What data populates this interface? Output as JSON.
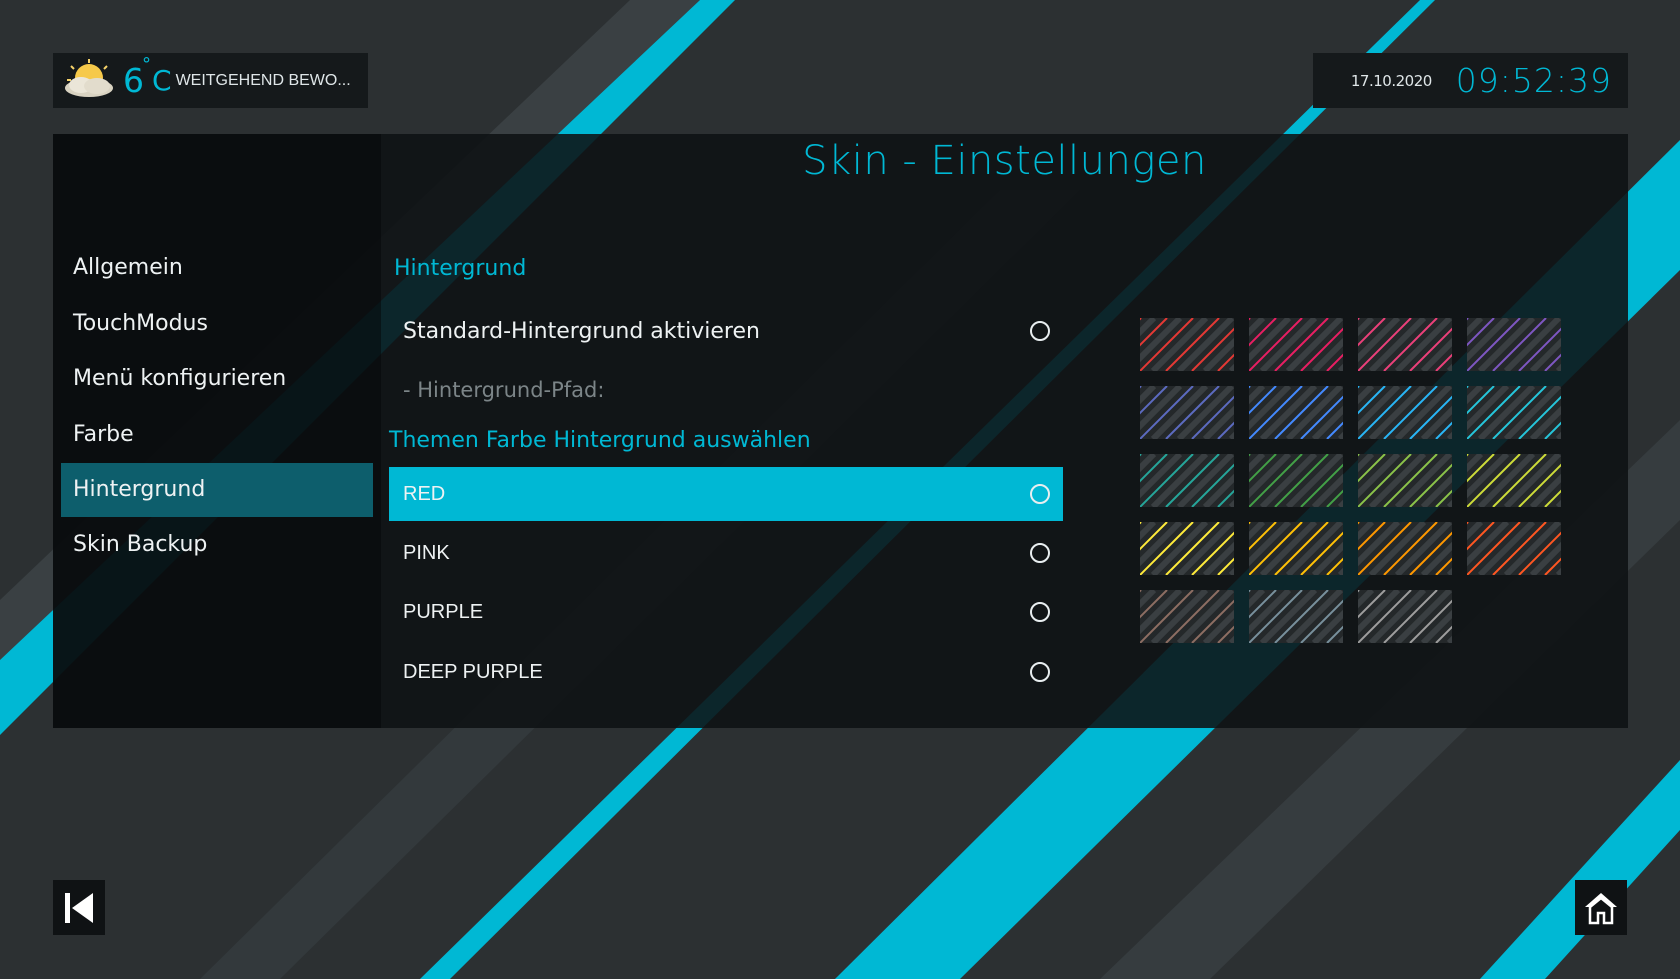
{
  "colors": {
    "accent": "#00b8d4",
    "accent_dark": "#0d5e6c",
    "background": "#2c3032",
    "panel": "#0e1113"
  },
  "header": {
    "weather": {
      "icon": "partly-cloudy-icon",
      "temperature": "6",
      "unit_symbol": "C",
      "degree_symbol": "°",
      "condition": "WEITGEHEND BEWO..."
    },
    "date": "17.10.2020",
    "time": "09:52:39"
  },
  "panel": {
    "title": "Skin - Einstellungen"
  },
  "sidebar": {
    "items": [
      {
        "label": "Allgemein",
        "active": false
      },
      {
        "label": "TouchModus",
        "active": false
      },
      {
        "label": "Menü konfigurieren",
        "active": false
      },
      {
        "label": "Farbe",
        "active": false
      },
      {
        "label": "Hintergrund",
        "active": true
      },
      {
        "label": "Skin Backup",
        "active": false
      }
    ]
  },
  "settings": {
    "section_title": "Hintergrund",
    "standard_background": {
      "label": "Standard-Hintergrund aktivieren",
      "checked": false
    },
    "background_path": {
      "label": "- Hintergrund-Pfad:"
    },
    "theme_section_title": "Themen Farbe Hintergrund auswählen",
    "theme_colors": [
      {
        "label": "RED",
        "selected": true
      },
      {
        "label": "PINK",
        "selected": false
      },
      {
        "label": "PURPLE",
        "selected": false
      },
      {
        "label": "DEEP PURPLE",
        "selected": false
      }
    ]
  },
  "swatches": [
    {
      "color": "#e53935"
    },
    {
      "color": "#e91e63"
    },
    {
      "color": "#ec407a"
    },
    {
      "color": "#7e57c2"
    },
    {
      "color": "#5c6bc0"
    },
    {
      "color": "#448aff"
    },
    {
      "color": "#29b6f6"
    },
    {
      "color": "#26c6da"
    },
    {
      "color": "#26a69a"
    },
    {
      "color": "#43a047"
    },
    {
      "color": "#8bc34a"
    },
    {
      "color": "#cddc39"
    },
    {
      "color": "#ffeb3b"
    },
    {
      "color": "#ffc107"
    },
    {
      "color": "#ff9800"
    },
    {
      "color": "#ff5722"
    },
    {
      "color": "#8d6e63"
    },
    {
      "color": "#78909c"
    },
    {
      "color": "#9e9e9e"
    }
  ],
  "footer": {
    "back_icon": "skip-back-icon",
    "home_icon": "home-icon"
  }
}
